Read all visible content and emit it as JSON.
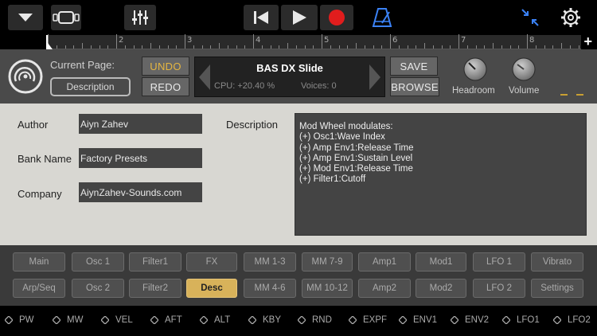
{
  "colors": {
    "accent": "#e6b640",
    "record": "#e11d1d",
    "metronome": "#3b82f6",
    "active_page": "#d8b25a"
  },
  "toolbar": {
    "icons": [
      "chevron-down-icon",
      "view-toggle-icon",
      "mixer-sliders-icon",
      "skip-back-icon",
      "play-icon",
      "record-icon",
      "metronome-icon",
      "collapse-icon",
      "settings-gear-icon"
    ]
  },
  "ruler": {
    "bars": [
      "2",
      "3",
      "4",
      "5",
      "6",
      "7",
      "8"
    ],
    "add_icon": "plus-icon",
    "add_label": "+"
  },
  "header": {
    "current_page_label": "Current Page:",
    "current_page_value": "Description",
    "undo_label": "UNDO",
    "redo_label": "REDO",
    "preset_name": "BAS DX Slide",
    "cpu_text": "CPU: +20.40 %",
    "voices_text": "Voices: 0",
    "save_label": "SAVE",
    "browse_label": "BROWSE",
    "headroom_label": "Headroom",
    "volume_label": "Volume"
  },
  "description_page": {
    "author_label": "Author",
    "author_value": "Aiyn Zahev",
    "bank_label": "Bank Name",
    "bank_value": "Factory Presets",
    "company_label": "Company",
    "company_value": "AiynZahev-Sounds.com",
    "description_label": "Description",
    "description_lines": [
      "Mod Wheel modulates:",
      "(+) Osc1:Wave Index",
      "(+) Amp Env1:Release Time",
      "(+) Amp Env1:Sustain Level",
      "(+) Mod Env1:Release Time",
      "(+) Filter1:Cutoff"
    ]
  },
  "pages": {
    "row1": [
      "Main",
      "Osc 1",
      "Filter1",
      "FX",
      "MM 1-3",
      "MM 7-9",
      "Amp1",
      "Mod1",
      "LFO 1",
      "Vibrato"
    ],
    "row2": [
      "Arp/Seq",
      "Osc 2",
      "Filter2",
      "Desc",
      "MM 4-6",
      "MM 10-12",
      "Amp2",
      "Mod2",
      "LFO 2",
      "Settings"
    ],
    "active": "Desc"
  },
  "mod_sources": [
    "PW",
    "MW",
    "VEL",
    "AFT",
    "ALT",
    "KBY",
    "RND",
    "EXPF",
    "ENV1",
    "ENV2",
    "LFO1",
    "LFO2"
  ]
}
